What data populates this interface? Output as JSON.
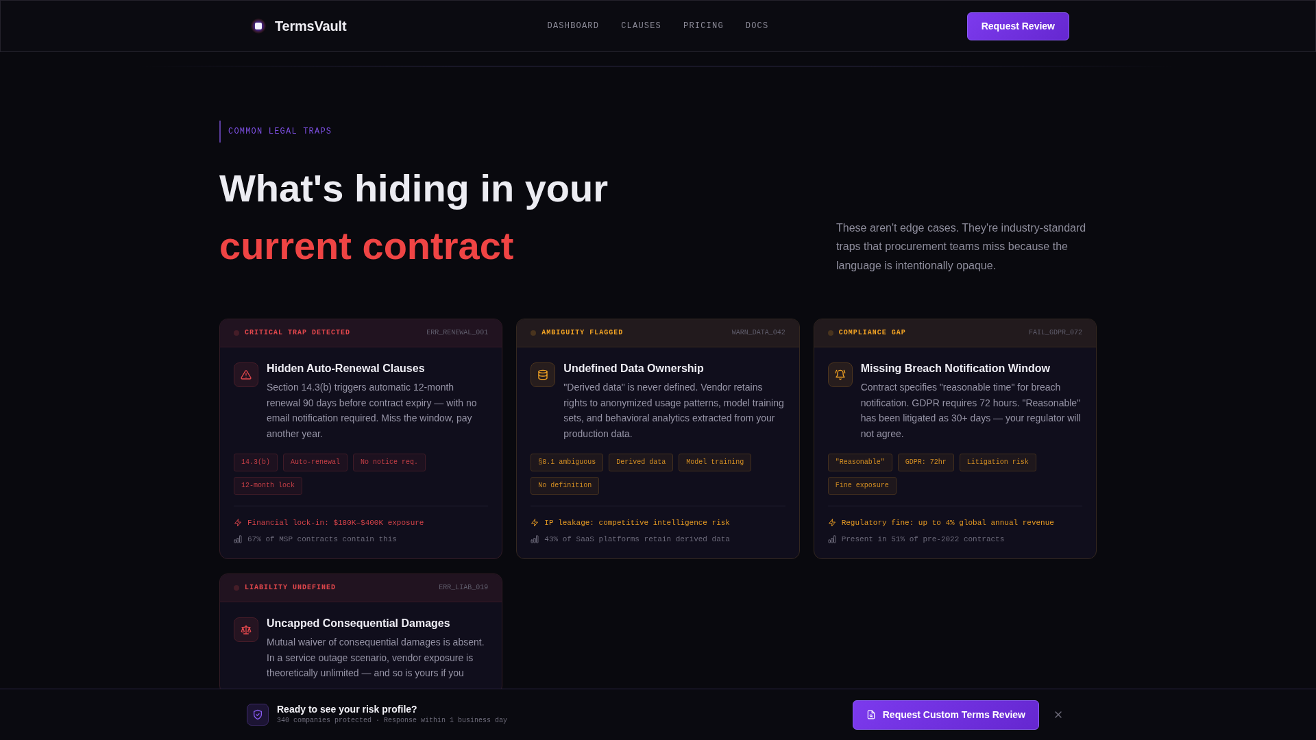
{
  "header": {
    "brand": "TermsVault",
    "nav": [
      "DASHBOARD",
      "CLAUSES",
      "PRICING",
      "DOCS"
    ],
    "button": "Request Review"
  },
  "hero": {
    "eyebrow": "COMMON LEGAL TRAPS",
    "title": "What's hiding in your",
    "title_highlight": "current contract",
    "intro": "These aren't edge cases. They're industry-standard traps that procurement teams miss because the language is intentionally opaque."
  },
  "cards": [
    {
      "color": "#e5484d",
      "label": "CRITICAL TRAP DETECTED",
      "code": "ERR_RENEWAL_001",
      "title": "Hidden Auto-Renewal Clauses",
      "description": "Section 14.3(b) triggers automatic 12-month renewal 90 days before contract expiry — with no email notification required. Miss the window, pay another year.",
      "tags": [
        "14.3(b)",
        "Auto-renewal",
        "No notice req.",
        "12-month lock"
      ],
      "impact": "Financial lock-in: $180K–$400K exposure",
      "stat": "67% of MSP contracts contain this"
    },
    {
      "color": "#f5a524",
      "label": "AMBIGUITY FLAGGED",
      "code": "WARN_DATA_042",
      "title": "Undefined Data Ownership",
      "description": "\"Derived data\" is never defined. Vendor retains rights to anonymized usage patterns, model training sets, and behavioral analytics extracted from your production data.",
      "tags": [
        "§8.1 ambiguous",
        "Derived data",
        "Model training",
        "No definition"
      ],
      "impact": "IP leakage: competitive intelligence risk",
      "stat": "43% of SaaS platforms retain derived data"
    },
    {
      "color": "#f5a524",
      "label": "COMPLIANCE GAP",
      "code": "FAIL_GDPR_072",
      "title": "Missing Breach Notification Window",
      "description": "Contract specifies \"reasonable time\" for breach notification. GDPR requires 72 hours. \"Reasonable\" has been litigated as 30+ days — your regulator will not agree.",
      "tags": [
        "\"Reasonable\"",
        "GDPR: 72hr",
        "Litigation risk",
        "Fine exposure"
      ],
      "impact": "Regulatory fine: up to 4% global annual revenue",
      "stat": "Present in 51% of pre-2022 contracts"
    },
    {
      "color": "#e5484d",
      "label": "LIABILITY UNDEFINED",
      "code": "ERR_LIAB_019",
      "title": "Uncapped Consequential Damages",
      "description": "Mutual waiver of consequential damages is absent. In a service outage scenario, vendor exposure is theoretically unlimited — and so is yours if you"
    }
  ],
  "cta_bar": {
    "title": "Ready to see your risk profile?",
    "subtitle": "340 companies protected · Response within 1 business day",
    "button": "Request Custom Terms Review"
  }
}
